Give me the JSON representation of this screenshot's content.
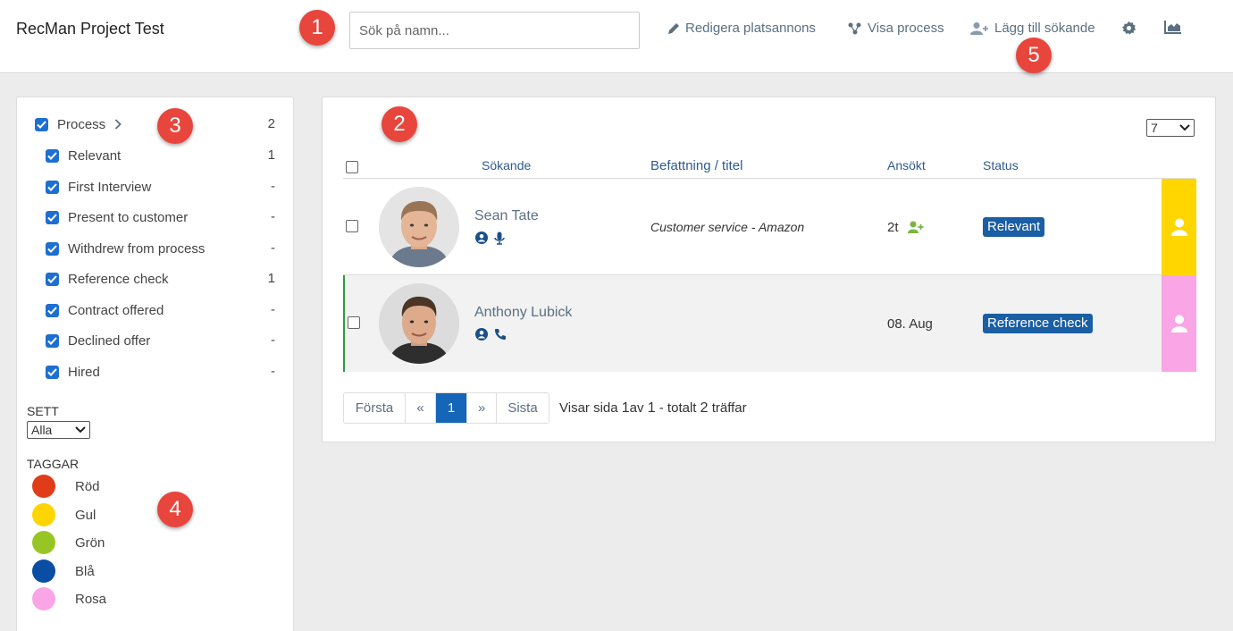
{
  "header": {
    "title": "RecMan Project Test",
    "search_placeholder": "Sök på namn...",
    "links": {
      "edit_ad": "Redigera platsannons",
      "show_process": "Visa process",
      "add_applicant": "Lägg till sökande"
    },
    "icons": [
      "gear-icon",
      "chart-icon"
    ]
  },
  "callouts": [
    "1",
    "2",
    "3",
    "4",
    "5"
  ],
  "sidebar": {
    "process": {
      "label": "Process",
      "count": "2",
      "checked": true
    },
    "stages": [
      {
        "label": "Relevant",
        "count": "1",
        "checked": true
      },
      {
        "label": "First Interview",
        "count": "-",
        "checked": true
      },
      {
        "label": "Present to customer",
        "count": "-",
        "checked": true
      },
      {
        "label": "Withdrew from process",
        "count": "-",
        "checked": true
      },
      {
        "label": "Reference check",
        "count": "1",
        "checked": true
      },
      {
        "label": "Contract offered",
        "count": "-",
        "checked": true
      },
      {
        "label": "Declined offer",
        "count": "-",
        "checked": true
      },
      {
        "label": "Hired",
        "count": "-",
        "checked": true
      }
    ],
    "seen": {
      "label": "SETT",
      "value": "Alla"
    },
    "tags": {
      "label": "TAGGAR",
      "items": [
        {
          "name": "Röd",
          "color": "#e03c1a"
        },
        {
          "name": "Gul",
          "color": "#ffd500"
        },
        {
          "name": "Grön",
          "color": "#97c624"
        },
        {
          "name": "Blå",
          "color": "#0a4ea3"
        },
        {
          "name": "Rosa",
          "color": "#f9a5e6"
        }
      ]
    }
  },
  "table": {
    "per_page": "7",
    "columns": {
      "applicant": "Sökande",
      "position": "Befattning / titel",
      "applied": "Ansökt",
      "status": "Status"
    },
    "rows": [
      {
        "name": "Sean Tate",
        "position": "Customer service - Amazon",
        "applied": "2t",
        "status": "Relevant",
        "tag_color": "#ffd600",
        "icons": [
          "user-circle-icon",
          "microphone-icon"
        ]
      },
      {
        "name": "Anthony Lubick",
        "position": "",
        "applied": "08. Aug",
        "status": "Reference check",
        "tag_color": "#f9a5e6",
        "icons": [
          "user-circle-icon",
          "phone-icon"
        ]
      }
    ]
  },
  "pagination": {
    "first": "Första",
    "prev": "«",
    "current": "1",
    "next": "»",
    "last": "Sista",
    "info_prefix": "Visar sida",
    "page": "1",
    "info_of": "av",
    "pages": "1",
    "info_total": "- totalt",
    "total": "2",
    "info_suffix": "träffar"
  }
}
